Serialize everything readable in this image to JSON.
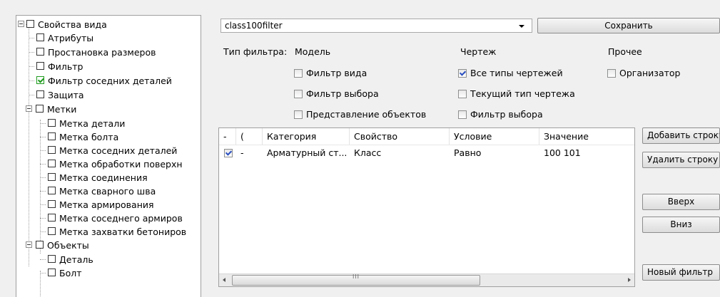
{
  "tree": {
    "root": "Свойства вида",
    "items": [
      {
        "label": "Атрибуты",
        "checked": false
      },
      {
        "label": "Простановка размеров",
        "checked": false
      },
      {
        "label": "Фильтр",
        "checked": false
      },
      {
        "label": "Фильтр соседних деталей",
        "checked": true
      },
      {
        "label": "Защита",
        "checked": false
      }
    ],
    "marks_group": "Метки",
    "marks": [
      "Метка детали",
      "Метка болта",
      "Метка соседних деталей",
      "Метка обработки поверхн",
      "Метка соединения",
      "Метка сварного шва",
      "Метка армирования",
      "Метка соседнего армиров",
      "Метка захватки бетониров"
    ],
    "objects_group": "Объекты",
    "objects": [
      "Деталь",
      "Болт"
    ]
  },
  "filter": {
    "name_value": "class100filter",
    "save_label": "Сохранить",
    "type_label": "Тип фильтра:",
    "columns": {
      "model": "Модель",
      "drawing": "Чертеж",
      "other": "Прочее"
    },
    "model_options": [
      {
        "label": "Фильтр вида",
        "checked": false
      },
      {
        "label": "Фильтр выбора",
        "checked": false
      },
      {
        "label": "Представление объектов",
        "checked": false
      }
    ],
    "drawing_options": [
      {
        "label": "Все типы чертежей",
        "checked": true
      },
      {
        "label": "Текущий тип чертежа",
        "checked": false
      },
      {
        "label": "Фильтр выбора",
        "checked": false
      }
    ],
    "other_options": [
      {
        "label": "Организатор",
        "checked": false
      }
    ]
  },
  "grid": {
    "headers": [
      "-",
      "(",
      "Категория",
      "Свойство",
      "Условие",
      "Значение"
    ],
    "rows": [
      {
        "checked": true,
        "paren": "-",
        "category": "Арматурный ст...",
        "property": "Класс",
        "condition": "Равно",
        "value": "100 101"
      }
    ],
    "scroll_mark": "III"
  },
  "buttons": {
    "add_row": "Добавить строку",
    "delete_row": "Удалить строку",
    "up": "Вверх",
    "down": "Вниз",
    "new_filter": "Новый фильтр"
  }
}
